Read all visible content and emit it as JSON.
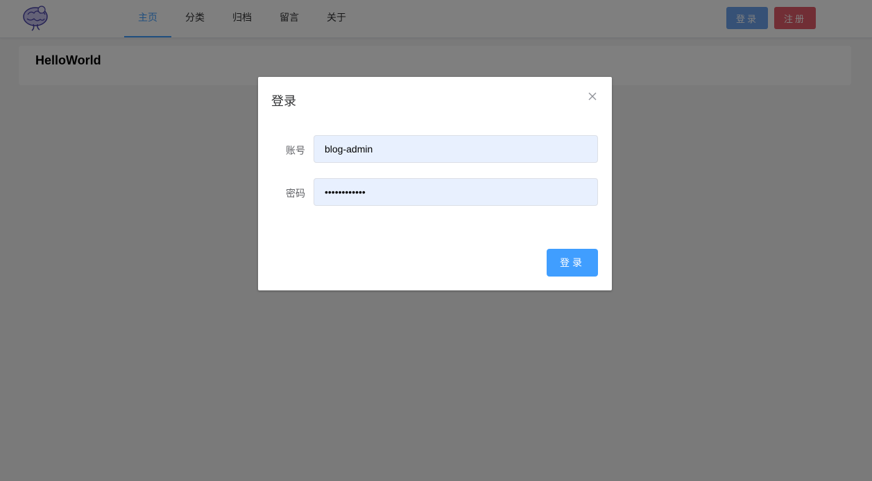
{
  "header": {
    "logo_icon": "brain-logo-icon",
    "nav": [
      {
        "label": "主页",
        "active": true
      },
      {
        "label": "分类",
        "active": false
      },
      {
        "label": "归档",
        "active": false
      },
      {
        "label": "留言",
        "active": false
      },
      {
        "label": "关于",
        "active": false
      }
    ],
    "login_label": "登录",
    "register_label": "注册"
  },
  "main": {
    "card_title": "HelloWorld"
  },
  "dialog": {
    "title": "登录",
    "close_icon": "close-icon",
    "username_label": "账号",
    "username_value": "blog-admin",
    "password_label": "密码",
    "password_value": "adminpasswrd",
    "submit_label": "登录"
  },
  "colors": {
    "accent": "#409eff",
    "danger": "#e35d6a",
    "autofill_bg": "#e8f0fe"
  }
}
